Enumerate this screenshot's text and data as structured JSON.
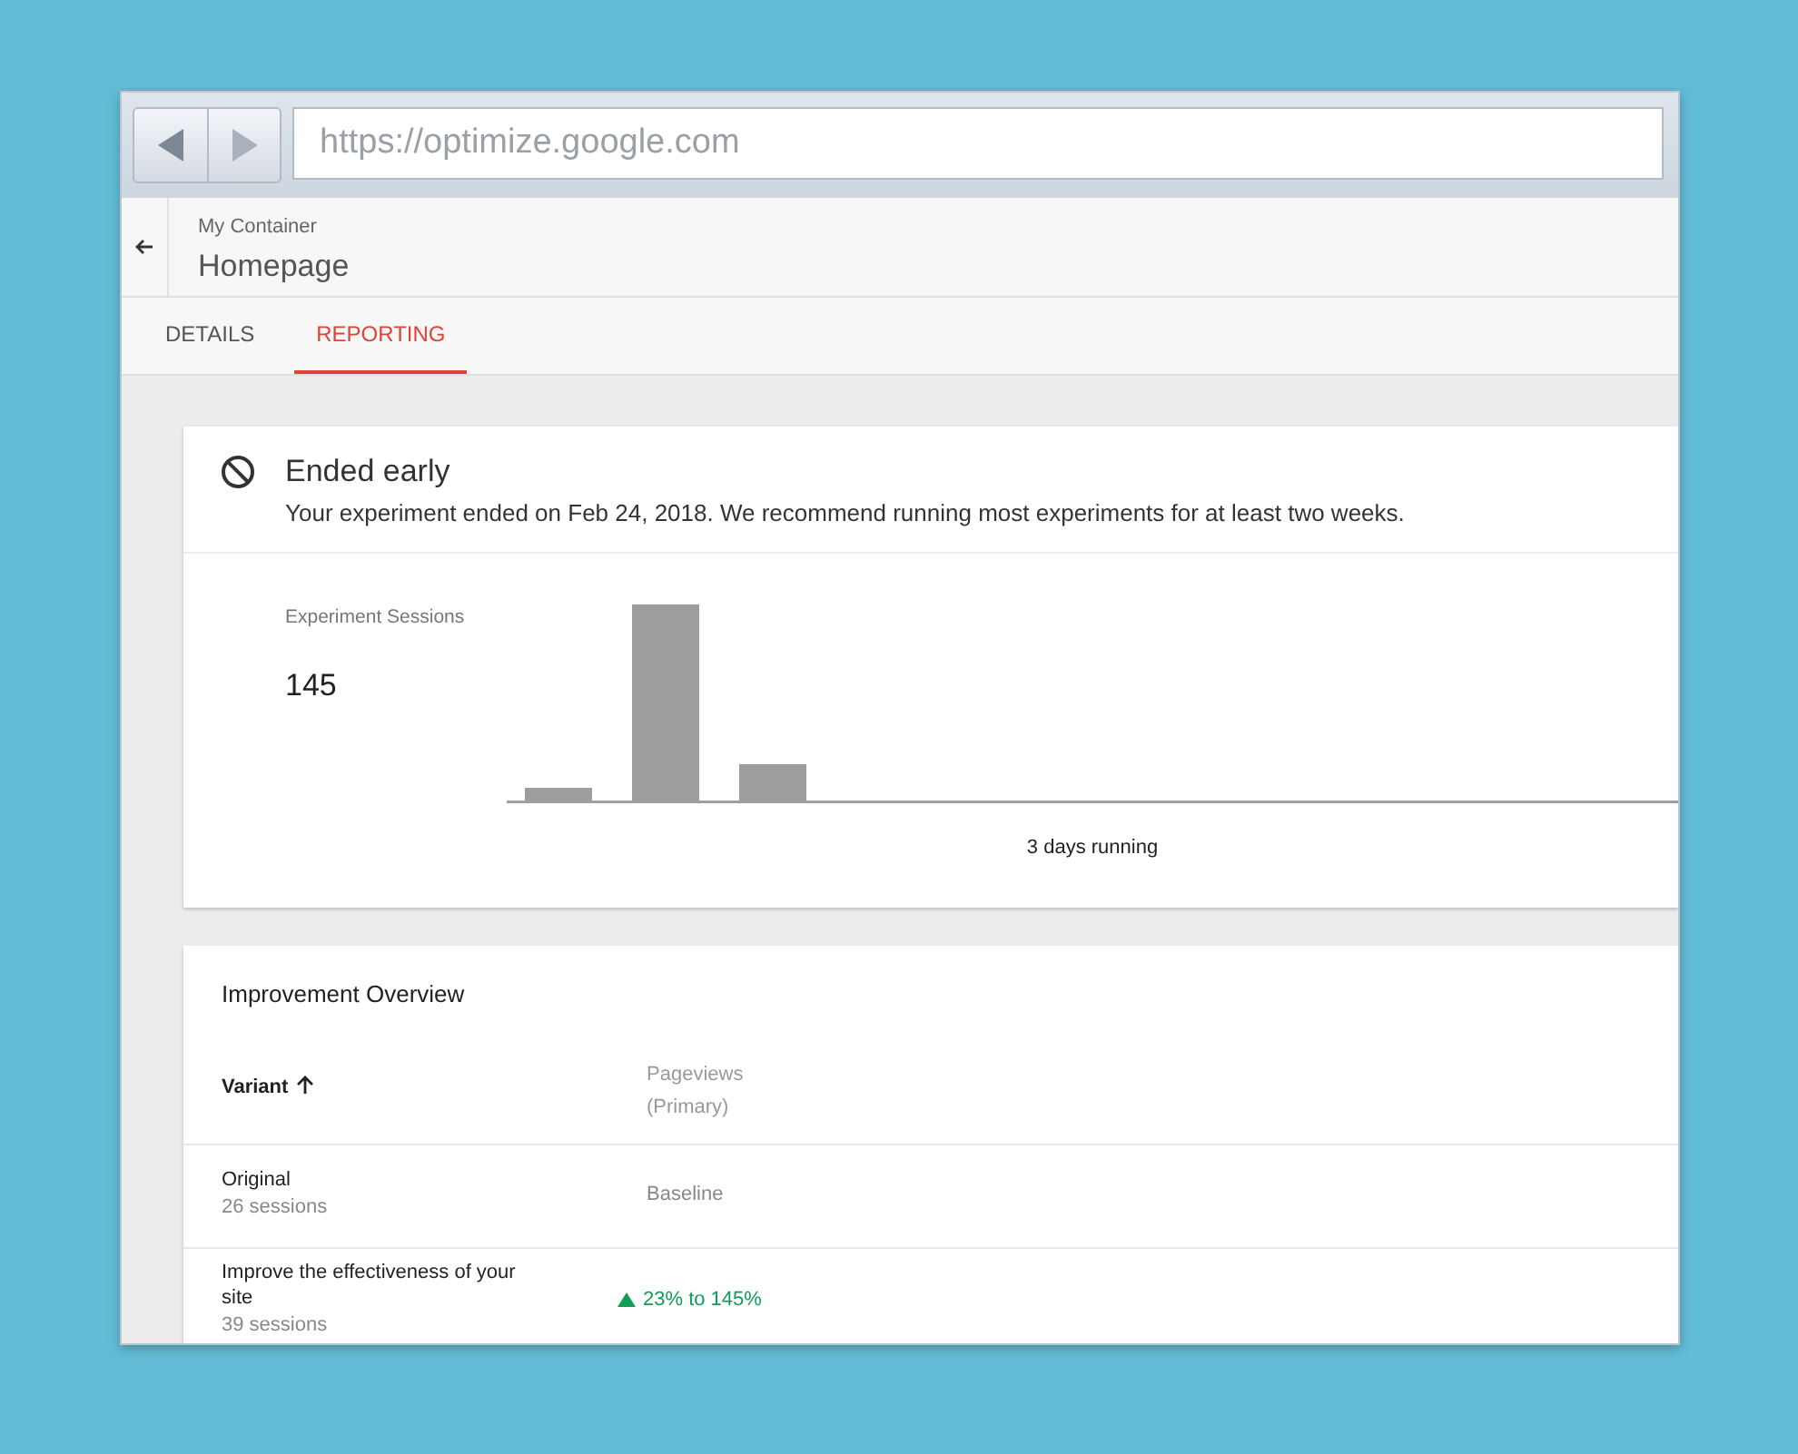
{
  "browser": {
    "url": "https://optimize.google.com"
  },
  "header": {
    "breadcrumb": "My Container",
    "title": "Homepage"
  },
  "tabs": [
    {
      "label": "DETAILS",
      "selected": false
    },
    {
      "label": "REPORTING",
      "selected": true
    }
  ],
  "status_card": {
    "title": "Ended early",
    "message": "Your experiment ended on Feb 24, 2018. We recommend running most experiments for at least two weeks.",
    "metric_label": "Experiment Sessions",
    "metric_value": "145",
    "chart_caption": "3 days running"
  },
  "overview": {
    "title": "Improvement Overview",
    "columns": [
      {
        "label": "Variant",
        "sorted": true
      },
      {
        "label": "Pageviews",
        "sub": "(Primary)",
        "sorted": false
      }
    ],
    "rows": [
      {
        "name": "Original",
        "sessions": "26 sessions",
        "kind": "baseline",
        "result": "Baseline"
      },
      {
        "name": "Improve the effectiveness of your site",
        "sessions": "39 sessions",
        "kind": "improvement",
        "result": "23% to 145%"
      }
    ]
  }
}
